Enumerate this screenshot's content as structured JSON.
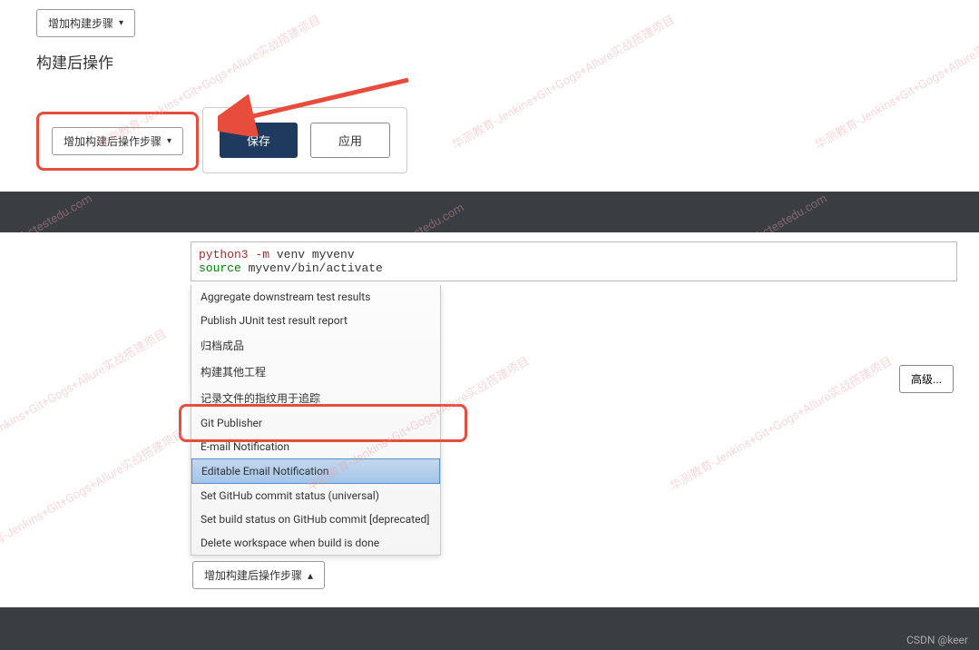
{
  "top": {
    "add_build_step": "增加构建步骤",
    "section_title": "构建后操作",
    "add_post_build_step": "增加构建后操作步骤",
    "save": "保存",
    "apply": "应用"
  },
  "bottom": {
    "code_line1_cmd": "python3",
    "code_line1_opt": "-m",
    "code_line1_rest": "venv myvenv",
    "code_line2_cmd": "source",
    "code_line2_rest": "myvenv/bin/activate",
    "menu_items": [
      "Aggregate downstream test results",
      "Publish JUnit test result report",
      "归档成品",
      "构建其他工程",
      "记录文件的指纹用于追踪",
      "Git Publisher",
      "E-mail Notification",
      "Editable Email Notification",
      "Set GitHub commit status (universal)",
      "Set build status on GitHub commit [deprecated]",
      "Delete workspace when build is done"
    ],
    "selected_index": 7,
    "add_post_build_step": "增加构建后操作步骤",
    "advanced": "高级..."
  },
  "watermarks": [
    "华测教育-Jenkins+Git+Gogs+Allure实战搭建项目",
    "www.hctestedu.com"
  ],
  "csdn": "CSDN @keer"
}
